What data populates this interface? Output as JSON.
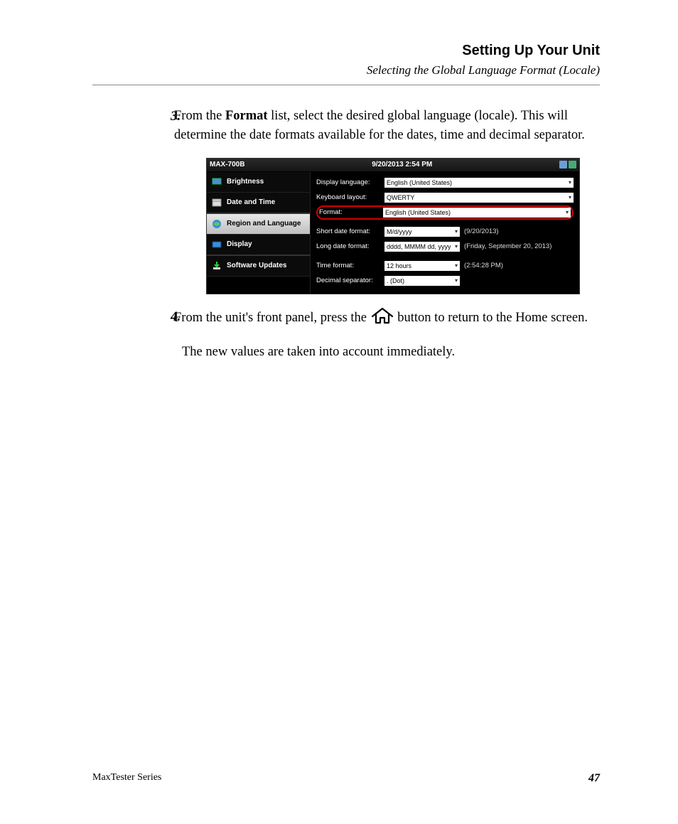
{
  "header": {
    "title": "Setting Up Your Unit",
    "subtitle": "Selecting the Global Language Format (Locale)"
  },
  "step3": {
    "num": "3.",
    "text_pre": "From the ",
    "text_bold": "Format",
    "text_post": " list, select the desired global language (locale). This will determine the date formats available for the dates, time and decimal separator."
  },
  "step4": {
    "num": "4.",
    "text_pre": "From the unit's front panel, press the ",
    "text_post": " button to return to the Home screen."
  },
  "closing": "The new values are taken into account immediately.",
  "footer": {
    "series": "MaxTester Series",
    "page": "47"
  },
  "shot": {
    "model": "MAX-700B",
    "time": "9/20/2013 2:54 PM",
    "sidebar": {
      "brightness": "Brightness",
      "datetime": "Date and Time",
      "region": "Region and Language",
      "display": "Display",
      "updates": "Software Updates"
    },
    "labels": {
      "display_language": "Display language:",
      "keyboard_layout": "Keyboard layout:",
      "format": "Format:",
      "short_date": "Short date format:",
      "long_date": "Long date format:",
      "time_format": "Time format:",
      "decimal_sep": "Decimal separator:"
    },
    "values": {
      "display_language": "English (United States)",
      "keyboard_layout": "QWERTY",
      "format": "English (United States)",
      "short_date": "M/d/yyyy",
      "long_date": "dddd, MMMM dd, yyyy",
      "time_format": "12 hours",
      "decimal_sep": ". (Dot)"
    },
    "previews": {
      "short_date": "(9/20/2013)",
      "long_date": "(Friday, September 20, 2013)",
      "time_format": "(2:54:28 PM)"
    }
  }
}
